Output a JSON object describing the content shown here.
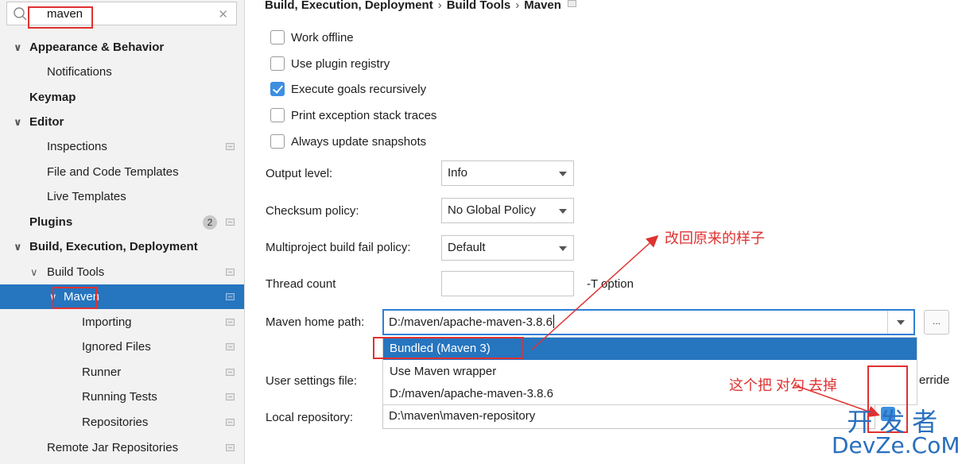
{
  "search": {
    "value": "maven"
  },
  "sidebar": {
    "items": [
      {
        "label": "Appearance & Behavior",
        "bold": true,
        "expanded": true
      },
      {
        "label": "Notifications"
      },
      {
        "label": "Keymap",
        "bold": true
      },
      {
        "label": "Editor",
        "bold": true,
        "expanded": true
      },
      {
        "label": "Inspections"
      },
      {
        "label": "File and Code Templates"
      },
      {
        "label": "Live Templates"
      },
      {
        "label": "Plugins",
        "bold": true,
        "badge": "2"
      },
      {
        "label": "Build, Execution, Deployment",
        "bold": true,
        "expanded": true
      },
      {
        "label": "Build Tools",
        "expanded": true
      },
      {
        "label": "Maven",
        "selected": true,
        "expanded": true
      },
      {
        "label": "Importing"
      },
      {
        "label": "Ignored Files"
      },
      {
        "label": "Runner"
      },
      {
        "label": "Running Tests"
      },
      {
        "label": "Repositories"
      },
      {
        "label": "Remote Jar Repositories"
      }
    ]
  },
  "breadcrumb": [
    "Build, Execution, Deployment",
    "Build Tools",
    "Maven"
  ],
  "options": [
    {
      "label": "Work offline",
      "checked": false
    },
    {
      "label": "Use plugin registry",
      "checked": false
    },
    {
      "label": "Execute goals recursively",
      "checked": true
    },
    {
      "label": "Print exception stack traces",
      "checked": false
    },
    {
      "label": "Always update snapshots",
      "checked": false
    }
  ],
  "fields": {
    "output_level": {
      "label": "Output level:",
      "value": "Info"
    },
    "checksum_policy": {
      "label": "Checksum policy:",
      "value": "No Global Policy"
    },
    "fail_policy": {
      "label": "Multiproject build fail policy:",
      "value": "Default"
    },
    "thread_count": {
      "label": "Thread count",
      "value": "",
      "suffix": "-T option"
    },
    "maven_home": {
      "label": "Maven home path:",
      "value": "D:/maven/apache-maven-3.8.6"
    },
    "user_settings": {
      "label": "User settings file:",
      "override_partial": "erride"
    },
    "local_repo": {
      "label": "Local repository:",
      "value": "D:\\maven\\maven-repository"
    }
  },
  "maven_home_options": [
    "Bundled (Maven 3)",
    "Use Maven wrapper",
    "D:/maven/apache-maven-3.8.6"
  ],
  "browse_label": "...",
  "annotations": {
    "revert": "改回原来的样子",
    "uncheck": "这个把 对勾 去掉"
  },
  "watermark": {
    "cn": "开发者",
    "en": "DevZe.CoM"
  },
  "colors": {
    "accent": "#2675bf",
    "annotation": "#e03131",
    "watermark": "#2a6fbe"
  }
}
